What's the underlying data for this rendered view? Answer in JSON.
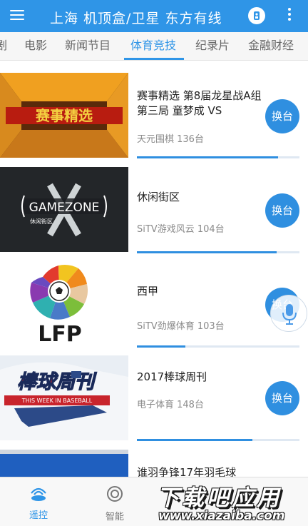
{
  "app": {
    "title": "上海 机顶盒/卫星 东方有线",
    "theme_color": "#2f95e7",
    "menu_icon": "hamburger-menu-icon",
    "remote_icon": "remote-icon",
    "more_icon": "more-vert-icon"
  },
  "tabs": [
    {
      "label": "剧",
      "active": false
    },
    {
      "label": "电影",
      "active": false
    },
    {
      "label": "新闻节目",
      "active": false
    },
    {
      "label": "体育竞技",
      "active": true
    },
    {
      "label": "纪录片",
      "active": false
    },
    {
      "label": "金融财经",
      "active": false
    }
  ],
  "channels": [
    {
      "title": "赛事精选 第8届龙星战A组第三局 童梦成 VS",
      "channel": "天元围棋 136台",
      "progress": 0.87,
      "button": "换台",
      "thumb_text": "赛事精选"
    },
    {
      "title": "休闲街区",
      "channel": "SiTV游戏风云 104台",
      "progress": 0.86,
      "button": "换台",
      "thumb_text": "GAMEZONE",
      "thumb_sub": "休闲街区"
    },
    {
      "title": "西甲",
      "channel": "SiTV劲爆体育 103台",
      "progress": 0.3,
      "button": "换台",
      "thumb_text": "LFP"
    },
    {
      "title": "2017棒球周刊",
      "channel": "电子体育 148台",
      "progress": 0.71,
      "button": "换台",
      "thumb_text": "棒球周刊",
      "thumb_sub": "THIS WEEK IN BASEBALL"
    },
    {
      "title": "谁羽争锋17年羽毛球",
      "channel": "",
      "progress": 0,
      "button": "",
      "thumb_text": ""
    }
  ],
  "voice_icon": "microphone-icon",
  "bottom_nav": [
    {
      "label": "遥控",
      "icon": "remote-signal-icon",
      "active": true
    },
    {
      "label": "智能",
      "icon": "smart-icon",
      "active": false
    }
  ],
  "watermark": {
    "main": "下载吧应用",
    "url": "www.xiazaiba.com"
  }
}
